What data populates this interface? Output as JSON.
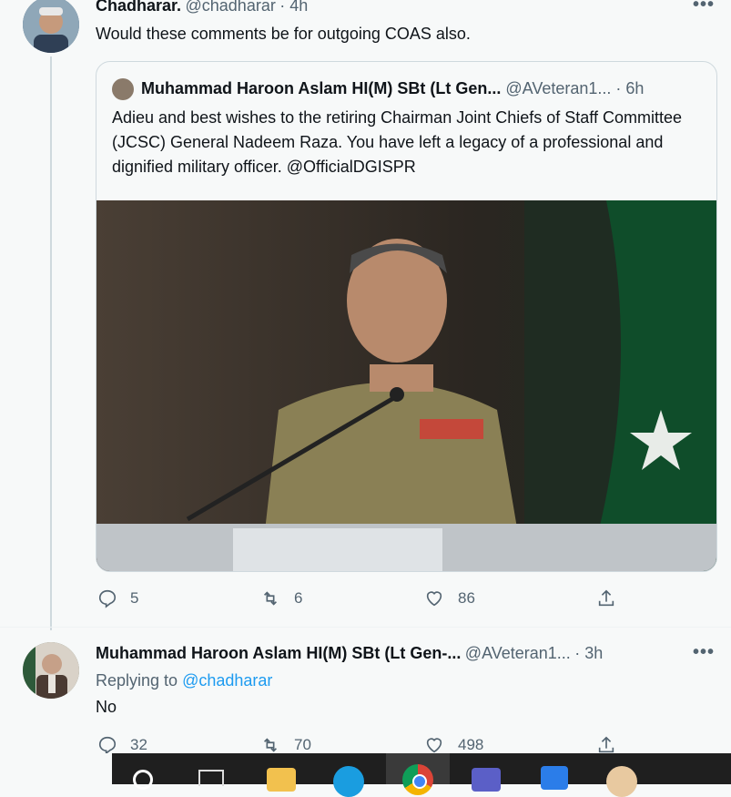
{
  "tweet1": {
    "name": "Chadharar.",
    "handle": "@chadharar",
    "time": "· 4h",
    "text": "Would these comments be for outgoing COAS also.",
    "more": "•••",
    "stats": {
      "replies": "5",
      "retweets": "6",
      "likes": "86"
    }
  },
  "quote": {
    "name": "Muhammad Haroon Aslam HI(M) SBt (Lt Gen...",
    "handle": "@AVeteran1...",
    "time": "· 6h",
    "text": "Adieu and best wishes to the retiring Chairman Joint Chiefs of Staff Committee (JCSC) General Nadeem Raza. You have left a legacy of a professional and dignified military officer. @OfficialDGISPR"
  },
  "tweet2": {
    "name": "Muhammad Haroon Aslam HI(M) SBt (Lt Gen-...",
    "handle": "@AVeteran1...",
    "time": "· 3h",
    "replying_prefix": "Replying to",
    "replying_to": "@chadharar",
    "text": "No",
    "more": "•••",
    "stats": {
      "replies": "32",
      "retweets": "70",
      "likes": "498"
    }
  },
  "colors": {
    "accent": "#1d9bf0",
    "muted": "#536471"
  }
}
